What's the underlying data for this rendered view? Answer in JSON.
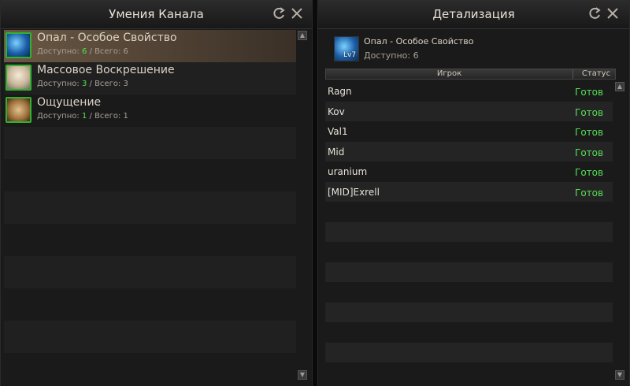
{
  "left": {
    "title": "Умения Канала",
    "skills": [
      {
        "name": "Опал - Особое Свойство",
        "avail_label": "Доступно:",
        "avail": "6",
        "sep": "/",
        "total_label": "Всего:",
        "total": "6",
        "icon": "opal-gem-icon",
        "selected": true
      },
      {
        "name": "Массовое Воскрешение",
        "avail_label": "Доступно:",
        "avail": "3",
        "sep": "/",
        "total_label": "Всего:",
        "total": "3",
        "icon": "resurrection-icon",
        "selected": false
      },
      {
        "name": "Ощущение",
        "avail_label": "Доступно:",
        "avail": "1",
        "sep": "/",
        "total_label": "Всего:",
        "total": "1",
        "icon": "sense-hand-icon",
        "selected": false
      }
    ],
    "refresh_icon": "refresh-icon",
    "close_icon": "close-icon"
  },
  "right": {
    "title": "Детализация",
    "skill": {
      "name": "Опал - Особое Свойство",
      "level": "Lv7",
      "avail_text": "Доступно:   6"
    },
    "columns": {
      "player": "Игрок",
      "status": "Статус"
    },
    "rows": [
      {
        "player": "Ragn",
        "status": "Готов"
      },
      {
        "player": "Kov",
        "status": "Готов"
      },
      {
        "player": "Val1",
        "status": "Готов"
      },
      {
        "player": "Mid",
        "status": "Готов"
      },
      {
        "player": "uranium",
        "status": "Готов"
      },
      {
        "player": "[MID]Exrell",
        "status": "Готов"
      }
    ],
    "status_color": "#55e055"
  }
}
